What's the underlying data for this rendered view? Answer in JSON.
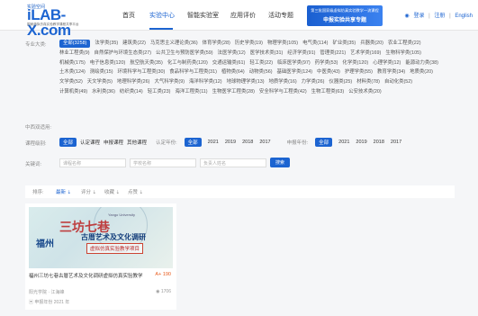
{
  "header": {
    "logo_mini": "实验空间",
    "logo_main": "iLAB-X.com",
    "logo_sub": "国家虚拟仿真实验教学课程共享平台",
    "nav": [
      "首页",
      "实验中心",
      "智能实验室",
      "应用评价",
      "活动专题"
    ],
    "active_nav": "实验中心",
    "banner_line1": "第三批国家级虚拟仿真实验教学一流课程",
    "banner_line2": "申报实验共享专题",
    "login": "登录",
    "register": "注册",
    "lang": "English",
    "accent": "#1c64d1"
  },
  "filters": {
    "major_label": "专业大类:",
    "majors": [
      "全部(3258)",
      "法学类(35)",
      "建筑类(22)",
      "马克思主义理论类(36)",
      "体育学类(28)",
      "历史学类(19)",
      "物理学类(105)",
      "电气类(114)",
      "矿业类(35)",
      "兵器类(20)",
      "农业工程类(22)",
      "林业工程类(9)",
      "自然保护与环境生态类(27)",
      "公共卫生与预防医学类(59)",
      "法医学类(12)",
      "医学技术类(31)",
      "经济学类(91)",
      "管理类(221)",
      "艺术学类(169)",
      "生物科学类(105)",
      "机械类(175)",
      "电子信息类(120)",
      "航空航天类(35)",
      "化工与制药类(120)",
      "交通运输类(61)",
      "轻工类(22)",
      "临床医学类(97)",
      "药学类(53)",
      "化学类(120)",
      "心理学类(12)",
      "能源动力类(38)",
      "土木类(124)",
      "测绘类(15)",
      "环境科学与工程类(30)",
      "食品科学与工程类(31)",
      "植物类(64)",
      "动物类(56)",
      "基础医学类(124)",
      "中医类(43)",
      "护理学类(55)",
      "教育学类(34)",
      "地质类(20)",
      "文学类(52)",
      "天文学类(5)",
      "地理科学类(26)",
      "大气科学类(9)",
      "海洋科学类(12)",
      "地球物理学类(13)",
      "地质学类(16)",
      "力学类(26)",
      "仪器类(25)",
      "材料类(78)",
      "自动化类(52)",
      "计算机类(49)",
      "水利类(36)",
      "纺织类(14)",
      "轻工类(23)",
      "海洋工程类(11)",
      "生物医学工程类(28)",
      "安全科学与工程类(42)",
      "生物工程类(63)",
      "公安技术类(20)"
    ],
    "national_label": "中西双适用:",
    "course_label": "课程级别:",
    "course_options": [
      "全部",
      "认定课程",
      "申报课程",
      "其他课程"
    ],
    "year_label": "认定年份:",
    "years": [
      "全部",
      "2021",
      "2019",
      "2018",
      "2017"
    ],
    "apply_year_label": "申报年份:",
    "apply_years": [
      "全部",
      "2021",
      "2019",
      "2018",
      "2017"
    ],
    "keyword_label": "关键词:",
    "course_name_placeholder": "课程名称",
    "school_placeholder": "学校名称",
    "leader_placeholder": "负责人姓名",
    "search_btn": "搜索"
  },
  "sort": {
    "label": "排序:",
    "options": [
      "最新",
      "评分",
      "收藏",
      "点赞"
    ],
    "active": "最新"
  },
  "card": {
    "thumb_big": "福州",
    "thumb_char": "三坊七巷",
    "thumb_title": "古厝艺术及文化调研",
    "thumb_tag": "虚拟仿真实验教学项目",
    "thumb_school": "Yango University",
    "title": "福州三坊七巷古厝艺术及文化调研虚拟仿真实验教学",
    "price": "A+ 190",
    "school": "阳光学院 · 江海峰",
    "views": "1706",
    "year": "申报年份 2021 年"
  }
}
